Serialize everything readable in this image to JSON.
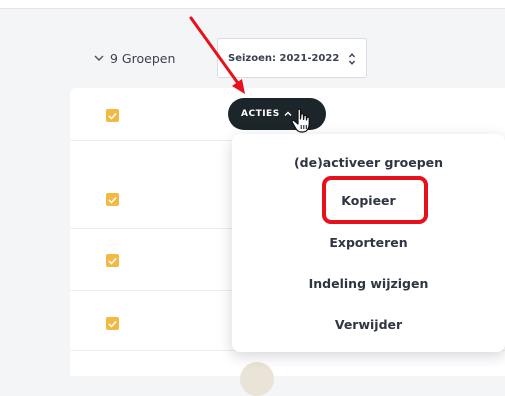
{
  "groups": {
    "toggle_label": "9 Groepen"
  },
  "season_select": {
    "value": "Seizoen: 2021-2022"
  },
  "actions_button": {
    "label": "ACTIES"
  },
  "actions_menu": {
    "items": [
      "(de)activeer groepen",
      "Kopieer",
      "Exporteren",
      "Indeling wijzigen",
      "Verwijder"
    ]
  },
  "icons": {
    "groups_toggle": "chevron-down-icon",
    "season_select": "select-arrows-icon",
    "actions_button": "chevron-up-icon",
    "cursor": "hand-pointer-icon",
    "checkbox": "checkbox-checked-icon"
  },
  "colors": {
    "checkbox": "#f4b942",
    "actions_button_bg": "#1c2529",
    "annotation_red": "#e8101b"
  }
}
